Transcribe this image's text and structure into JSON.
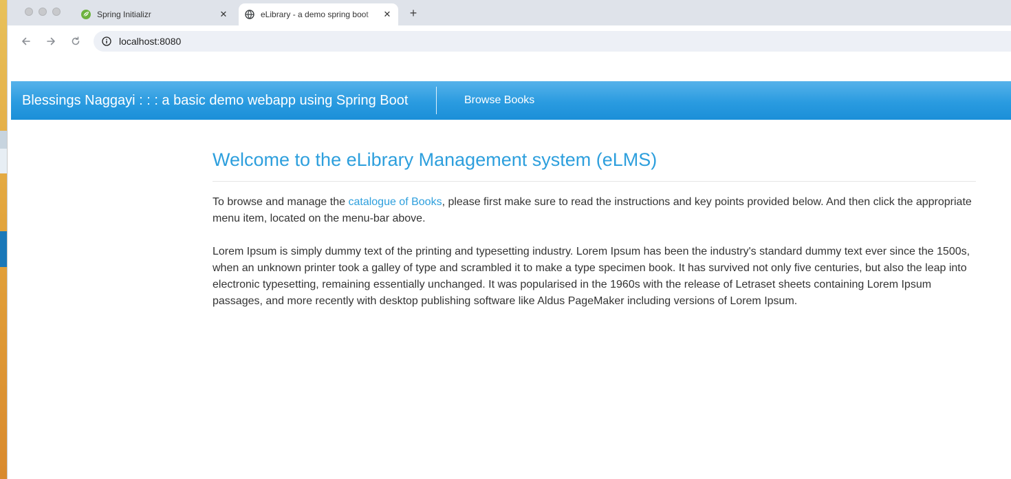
{
  "browser": {
    "tabs": [
      {
        "title": "Spring Initializr",
        "icon": "spring-leaf-icon",
        "active": false
      },
      {
        "title": "eLibrary - a demo spring boot",
        "icon": "globe-icon",
        "active": true
      }
    ],
    "new_tab_label": "+",
    "close_label": "✕",
    "url": "localhost:8080"
  },
  "navbar": {
    "brand": "Blessings Naggayi : : : a basic demo webapp using Spring Boot",
    "links": [
      {
        "label": "Browse Books"
      }
    ]
  },
  "main": {
    "heading": "Welcome to the eLibrary Management system (eLMS)",
    "intro_before_link": "To browse and manage the ",
    "intro_link": "catalogue of Books",
    "intro_after_link": ", please first make sure to read the instructions and key points provided below. And then click the appropriate menu item, located on the menu-bar above.",
    "lorem": "Lorem Ipsum is simply dummy text of the printing and typesetting industry. Lorem Ipsum has been the industry's standard dummy text ever since the 1500s, when an unknown printer took a galley of type and scrambled it to make a type specimen book. It has survived not only five centuries, but also the leap into electronic typesetting, remaining essentially unchanged. It was popularised in the 1960s with the release of Letraset sheets containing Lorem Ipsum passages, and more recently with desktop publishing software like Aldus PageMaker including versions of Lorem Ipsum."
  },
  "colors": {
    "navbar": "#2a9be0",
    "heading": "#2d9fdd",
    "link": "#2d9fdd",
    "tabstrip": "#dfe3ea",
    "omnibox": "#edf0f6"
  }
}
